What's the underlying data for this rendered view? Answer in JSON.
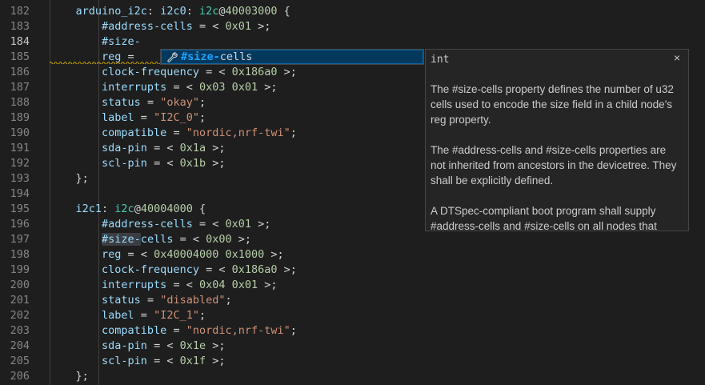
{
  "editor": {
    "lines": [
      {
        "num": "182",
        "tokens": [
          {
            "t": "    ",
            "c": "t-op"
          },
          {
            "t": "arduino_i2c",
            "c": "t-lbl"
          },
          {
            "t": ": ",
            "c": "t-op"
          },
          {
            "t": "i2c0",
            "c": "t-lbl"
          },
          {
            "t": ": ",
            "c": "t-op"
          },
          {
            "t": "i2c",
            "c": "t-node"
          },
          {
            "t": "@",
            "c": "t-op"
          },
          {
            "t": "40003000",
            "c": "t-num"
          },
          {
            "t": " {",
            "c": "t-op"
          }
        ]
      },
      {
        "num": "183",
        "tokens": [
          {
            "t": "        ",
            "c": "t-op"
          },
          {
            "t": "#address-cells",
            "c": "t-prop"
          },
          {
            "t": " = < ",
            "c": "t-op"
          },
          {
            "t": "0x01",
            "c": "t-num"
          },
          {
            "t": " >;",
            "c": "t-op"
          }
        ]
      },
      {
        "num": "184",
        "active": true,
        "tokens": [
          {
            "t": "        ",
            "c": "t-op"
          },
          {
            "t": "#size-",
            "c": "t-prop"
          }
        ]
      },
      {
        "num": "185",
        "tokens": [
          {
            "t": "        ",
            "c": "t-op"
          },
          {
            "t": "reg",
            "c": "t-prop"
          },
          {
            "t": " = ",
            "c": "t-op"
          }
        ]
      },
      {
        "num": "186",
        "tokens": [
          {
            "t": "        ",
            "c": "t-op"
          },
          {
            "t": "clock-frequency",
            "c": "t-prop"
          },
          {
            "t": " = < ",
            "c": "t-op"
          },
          {
            "t": "0x186a0",
            "c": "t-num"
          },
          {
            "t": " >;",
            "c": "t-op"
          }
        ]
      },
      {
        "num": "187",
        "tokens": [
          {
            "t": "        ",
            "c": "t-op"
          },
          {
            "t": "interrupts",
            "c": "t-prop"
          },
          {
            "t": " = < ",
            "c": "t-op"
          },
          {
            "t": "0x03 0x01",
            "c": "t-num"
          },
          {
            "t": " >;",
            "c": "t-op"
          }
        ]
      },
      {
        "num": "188",
        "tokens": [
          {
            "t": "        ",
            "c": "t-op"
          },
          {
            "t": "status",
            "c": "t-prop"
          },
          {
            "t": " = ",
            "c": "t-op"
          },
          {
            "t": "\"okay\"",
            "c": "t-str"
          },
          {
            "t": ";",
            "c": "t-op"
          }
        ]
      },
      {
        "num": "189",
        "tokens": [
          {
            "t": "        ",
            "c": "t-op"
          },
          {
            "t": "label",
            "c": "t-prop"
          },
          {
            "t": " = ",
            "c": "t-op"
          },
          {
            "t": "\"I2C_0\"",
            "c": "t-str"
          },
          {
            "t": ";",
            "c": "t-op"
          }
        ]
      },
      {
        "num": "190",
        "tokens": [
          {
            "t": "        ",
            "c": "t-op"
          },
          {
            "t": "compatible",
            "c": "t-prop"
          },
          {
            "t": " = ",
            "c": "t-op"
          },
          {
            "t": "\"nordic,nrf-twi\"",
            "c": "t-str"
          },
          {
            "t": ";",
            "c": "t-op"
          }
        ]
      },
      {
        "num": "191",
        "tokens": [
          {
            "t": "        ",
            "c": "t-op"
          },
          {
            "t": "sda-pin",
            "c": "t-prop"
          },
          {
            "t": " = < ",
            "c": "t-op"
          },
          {
            "t": "0x1a",
            "c": "t-num"
          },
          {
            "t": " >;",
            "c": "t-op"
          }
        ]
      },
      {
        "num": "192",
        "tokens": [
          {
            "t": "        ",
            "c": "t-op"
          },
          {
            "t": "scl-pin",
            "c": "t-prop"
          },
          {
            "t": " = < ",
            "c": "t-op"
          },
          {
            "t": "0x1b",
            "c": "t-num"
          },
          {
            "t": " >;",
            "c": "t-op"
          }
        ]
      },
      {
        "num": "193",
        "tokens": [
          {
            "t": "    };",
            "c": "t-op"
          }
        ]
      },
      {
        "num": "194",
        "tokens": []
      },
      {
        "num": "195",
        "tokens": [
          {
            "t": "    ",
            "c": "t-op"
          },
          {
            "t": "i2c1",
            "c": "t-lbl"
          },
          {
            "t": ": ",
            "c": "t-op"
          },
          {
            "t": "i2c",
            "c": "t-node"
          },
          {
            "t": "@",
            "c": "t-op"
          },
          {
            "t": "40004000",
            "c": "t-num"
          },
          {
            "t": " {",
            "c": "t-op"
          }
        ]
      },
      {
        "num": "196",
        "tokens": [
          {
            "t": "        ",
            "c": "t-op"
          },
          {
            "t": "#address-cells",
            "c": "t-prop"
          },
          {
            "t": " = < ",
            "c": "t-op"
          },
          {
            "t": "0x01",
            "c": "t-num"
          },
          {
            "t": " >;",
            "c": "t-op"
          }
        ]
      },
      {
        "num": "197",
        "tokens": [
          {
            "t": "        ",
            "c": "t-op"
          },
          {
            "t": "#size-",
            "c": "t-prop hl-word"
          },
          {
            "t": "cells",
            "c": "t-prop"
          },
          {
            "t": " = < ",
            "c": "t-op"
          },
          {
            "t": "0x00",
            "c": "t-num"
          },
          {
            "t": " >;",
            "c": "t-op"
          }
        ]
      },
      {
        "num": "198",
        "tokens": [
          {
            "t": "        ",
            "c": "t-op"
          },
          {
            "t": "reg",
            "c": "t-prop"
          },
          {
            "t": " = < ",
            "c": "t-op"
          },
          {
            "t": "0x40004000 0x1000",
            "c": "t-num"
          },
          {
            "t": " >;",
            "c": "t-op"
          }
        ]
      },
      {
        "num": "199",
        "tokens": [
          {
            "t": "        ",
            "c": "t-op"
          },
          {
            "t": "clock-frequency",
            "c": "t-prop"
          },
          {
            "t": " = < ",
            "c": "t-op"
          },
          {
            "t": "0x186a0",
            "c": "t-num"
          },
          {
            "t": " >;",
            "c": "t-op"
          }
        ]
      },
      {
        "num": "200",
        "tokens": [
          {
            "t": "        ",
            "c": "t-op"
          },
          {
            "t": "interrupts",
            "c": "t-prop"
          },
          {
            "t": " = < ",
            "c": "t-op"
          },
          {
            "t": "0x04 0x01",
            "c": "t-num"
          },
          {
            "t": " >;",
            "c": "t-op"
          }
        ]
      },
      {
        "num": "201",
        "tokens": [
          {
            "t": "        ",
            "c": "t-op"
          },
          {
            "t": "status",
            "c": "t-prop"
          },
          {
            "t": " = ",
            "c": "t-op"
          },
          {
            "t": "\"disabled\"",
            "c": "t-str"
          },
          {
            "t": ";",
            "c": "t-op"
          }
        ]
      },
      {
        "num": "202",
        "tokens": [
          {
            "t": "        ",
            "c": "t-op"
          },
          {
            "t": "label",
            "c": "t-prop"
          },
          {
            "t": " = ",
            "c": "t-op"
          },
          {
            "t": "\"I2C_1\"",
            "c": "t-str"
          },
          {
            "t": ";",
            "c": "t-op"
          }
        ]
      },
      {
        "num": "203",
        "tokens": [
          {
            "t": "        ",
            "c": "t-op"
          },
          {
            "t": "compatible",
            "c": "t-prop"
          },
          {
            "t": " = ",
            "c": "t-op"
          },
          {
            "t": "\"nordic,nrf-twi\"",
            "c": "t-str"
          },
          {
            "t": ";",
            "c": "t-op"
          }
        ]
      },
      {
        "num": "204",
        "tokens": [
          {
            "t": "        ",
            "c": "t-op"
          },
          {
            "t": "sda-pin",
            "c": "t-prop"
          },
          {
            "t": " = < ",
            "c": "t-op"
          },
          {
            "t": "0x1e",
            "c": "t-num"
          },
          {
            "t": " >;",
            "c": "t-op"
          }
        ]
      },
      {
        "num": "205",
        "tokens": [
          {
            "t": "        ",
            "c": "t-op"
          },
          {
            "t": "scl-pin",
            "c": "t-prop"
          },
          {
            "t": " = < ",
            "c": "t-op"
          },
          {
            "t": "0x1f",
            "c": "t-num"
          },
          {
            "t": " >;",
            "c": "t-op"
          }
        ]
      },
      {
        "num": "206",
        "tokens": [
          {
            "t": "    };",
            "c": "t-op"
          }
        ]
      }
    ]
  },
  "suggest": {
    "icon": "wrench-icon",
    "match": "#size-",
    "rest": "cells"
  },
  "details": {
    "type": "int",
    "close": "×",
    "paragraphs": [
      "The #size-cells property defines the number of u32 cells used to encode the size field in a child node's reg property.",
      "The #address-cells and #size-cells properties are not inherited from ancestors in the devicetree. They shall be explicitly defined.",
      "A DTSpec-compliant boot program shall supply #address-cells and #size-cells on all nodes that"
    ]
  },
  "colors": {
    "background": "#1e1e1e",
    "suggest_highlight": "#18a3ff",
    "squiggle": "#cca700"
  }
}
